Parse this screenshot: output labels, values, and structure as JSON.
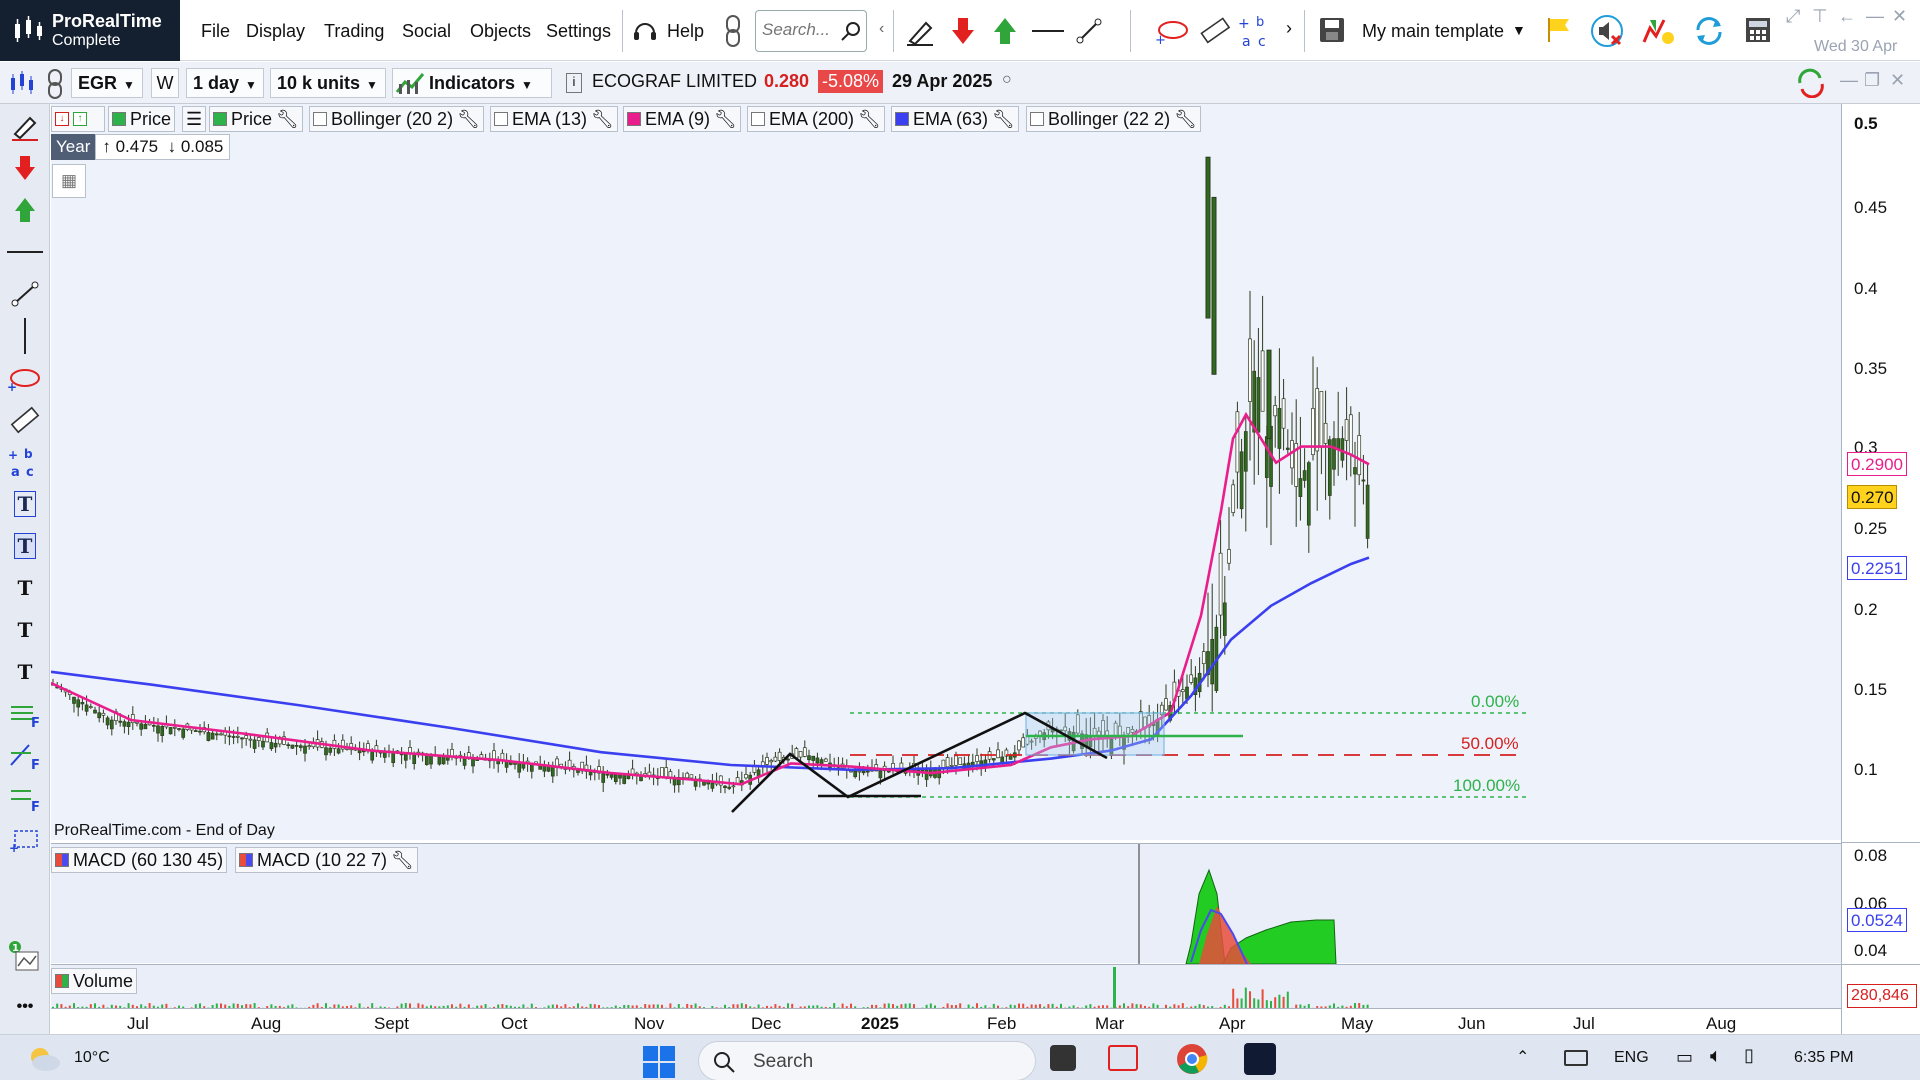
{
  "app": {
    "brand_name": "ProRealTime",
    "brand_edition": "Complete",
    "date_label": "Wed 30 Apr"
  },
  "menu": {
    "items": [
      "File",
      "Display",
      "Trading",
      "Social",
      "Objects",
      "Settings",
      "Help"
    ],
    "search_placeholder": "Search...",
    "template": "My main template"
  },
  "chart_toolbar": {
    "ticker": "EGR",
    "w_label": "W",
    "period": "1 day",
    "units": "10 k units",
    "indicators": "Indicators",
    "company": "ECOGRAF LIMITED",
    "last_price": "0.280",
    "change": "-5.08%",
    "date": "29 Apr 2025"
  },
  "legend": {
    "items": [
      {
        "label": "Price",
        "color": "#2db34a"
      },
      {
        "label": "Price",
        "color": "#2db34a"
      },
      {
        "label": "Bollinger (20 2)",
        "color": ""
      },
      {
        "label": "EMA (13)",
        "color": ""
      },
      {
        "label": "EMA (9)",
        "color": "#e91e8c"
      },
      {
        "label": "EMA (200)",
        "color": ""
      },
      {
        "label": "EMA (63)",
        "color": "#3a3ff0"
      },
      {
        "label": "Bollinger (22 2)",
        "color": ""
      }
    ],
    "year_label": "Year",
    "year_high": "0.475",
    "year_low": "0.085",
    "source_note": "ProRealTime.com - End of Day"
  },
  "price_axis": {
    "ticks": [
      "0.5",
      "0.45",
      "0.4",
      "0.35",
      "0.3",
      "0.25",
      "0.2",
      "0.15",
      "0.1"
    ],
    "ema9_flag": "0.2900",
    "price_flag": "0.270",
    "ema63_flag": "0.2251"
  },
  "fib_levels": [
    "0.00%",
    "50.00%",
    "100.00%"
  ],
  "macd": {
    "labels": [
      "MACD (60 130 45)",
      "MACD (10 22 7)"
    ],
    "ticks": [
      "0.08",
      "0.06",
      "0.04"
    ],
    "flag": "0.0524"
  },
  "volume": {
    "label": "Volume",
    "flag": "280,846"
  },
  "date_axis": [
    "Jul",
    "Aug",
    "Sept",
    "Oct",
    "Nov",
    "Dec",
    "2025",
    "Feb",
    "Mar",
    "Apr",
    "May",
    "Jun",
    "Jul",
    "Aug"
  ],
  "taskbar": {
    "temperature": "10°C",
    "search_label": "Search",
    "language": "ENG",
    "time": "6:35 PM"
  },
  "colors": {
    "ema9": "#e91e8c",
    "ema63": "#3a3ff0",
    "candle": "#2e6b1e",
    "fib": "#2db34a",
    "fib_mid": "#d62020"
  }
}
